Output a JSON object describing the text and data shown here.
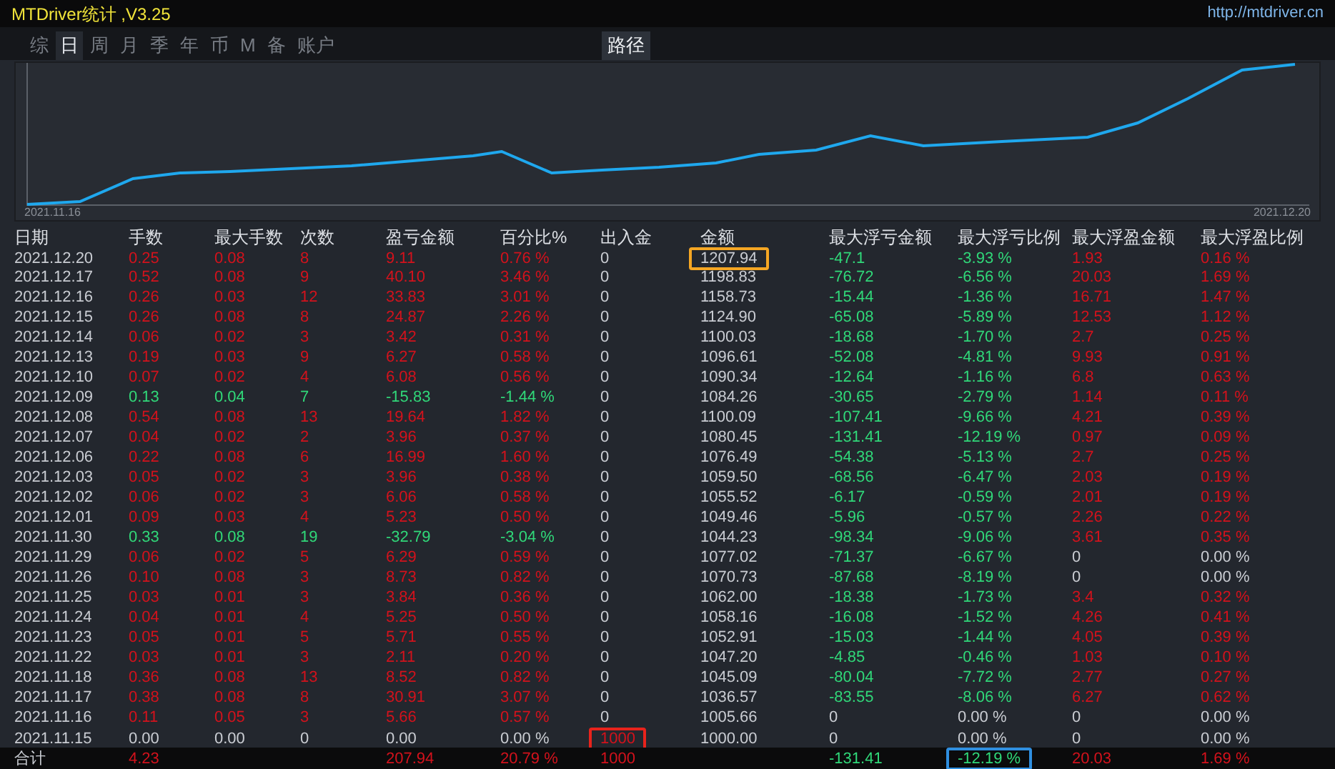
{
  "window": {
    "title": "MTDriver统计 ,V3.25",
    "link": "http://mtdriver.cn"
  },
  "tabs": [
    {
      "label": "综",
      "selected": false
    },
    {
      "label": "日",
      "selected": true
    },
    {
      "label": "周",
      "selected": false
    },
    {
      "label": "月",
      "selected": false
    },
    {
      "label": "季",
      "selected": false
    },
    {
      "label": "年",
      "selected": false
    },
    {
      "label": "币",
      "selected": false
    },
    {
      "label": "M",
      "selected": false
    },
    {
      "label": "备",
      "selected": false
    },
    {
      "label": "账户",
      "selected": false
    }
  ],
  "view_tabs": [
    {
      "label": "路径",
      "selected": true
    }
  ],
  "chart": {
    "start_label": "2021.11.16",
    "end_label": "2021.12.20"
  },
  "table": {
    "columns": [
      "日期",
      "手数",
      "最大手数",
      "次数",
      "盈亏金额",
      "百分比%",
      "出入金",
      "金额",
      "最大浮亏金额",
      "最大浮亏比例",
      "最大浮盈金额",
      "最大浮盈比例"
    ],
    "rows": [
      [
        {
          "text": "2021.12.20",
          "kind": "plain"
        },
        {
          "text": "0.25",
          "kind": "profit"
        },
        {
          "text": "0.08",
          "kind": "profit"
        },
        {
          "text": "8",
          "kind": "profit"
        },
        {
          "text": "9.11",
          "kind": "profit"
        },
        {
          "text": "0.76 %",
          "kind": "profit"
        },
        {
          "text": "0",
          "kind": "plain"
        },
        {
          "text": "1207.94",
          "kind": "plain",
          "color": "#f5a623"
        },
        {
          "text": "-47.1",
          "kind": "loss"
        },
        {
          "text": "-3.93 %",
          "kind": "loss"
        },
        {
          "text": "1.93",
          "kind": "profit"
        },
        {
          "text": "0.16 %",
          "kind": "profit"
        }
      ],
      [
        {
          "text": "2021.12.17",
          "kind": "plain"
        },
        {
          "text": "0.52",
          "kind": "profit"
        },
        {
          "text": "0.08",
          "kind": "profit"
        },
        {
          "text": "9",
          "kind": "profit"
        },
        {
          "text": "40.10",
          "kind": "profit"
        },
        {
          "text": "3.46 %",
          "kind": "profit"
        },
        {
          "text": "0",
          "kind": "plain"
        },
        {
          "text": "1198.83",
          "kind": "plain"
        },
        {
          "text": "-76.72",
          "kind": "loss"
        },
        {
          "text": "-6.56 %",
          "kind": "loss"
        },
        {
          "text": "20.03",
          "kind": "profit"
        },
        {
          "text": "1.69 %",
          "kind": "profit"
        }
      ],
      [
        {
          "text": "2021.12.16",
          "kind": "plain"
        },
        {
          "text": "0.26",
          "kind": "profit"
        },
        {
          "text": "0.03",
          "kind": "profit"
        },
        {
          "text": "12",
          "kind": "profit"
        },
        {
          "text": "33.83",
          "kind": "profit"
        },
        {
          "text": "3.01 %",
          "kind": "profit"
        },
        {
          "text": "0",
          "kind": "plain"
        },
        {
          "text": "1158.73",
          "kind": "plain"
        },
        {
          "text": "-15.44",
          "kind": "loss"
        },
        {
          "text": "-1.36 %",
          "kind": "loss"
        },
        {
          "text": "16.71",
          "kind": "profit"
        },
        {
          "text": "1.47 %",
          "kind": "profit"
        }
      ],
      [
        {
          "text": "2021.12.15",
          "kind": "plain"
        },
        {
          "text": "0.26",
          "kind": "profit"
        },
        {
          "text": "0.08",
          "kind": "profit"
        },
        {
          "text": "8",
          "kind": "profit"
        },
        {
          "text": "24.87",
          "kind": "profit"
        },
        {
          "text": "2.26 %",
          "kind": "profit"
        },
        {
          "text": "0",
          "kind": "plain"
        },
        {
          "text": "1124.90",
          "kind": "plain"
        },
        {
          "text": "-65.08",
          "kind": "loss"
        },
        {
          "text": "-5.89 %",
          "kind": "loss"
        },
        {
          "text": "12.53",
          "kind": "profit"
        },
        {
          "text": "1.12 %",
          "kind": "profit"
        }
      ],
      [
        {
          "text": "2021.12.14",
          "kind": "plain"
        },
        {
          "text": "0.06",
          "kind": "profit"
        },
        {
          "text": "0.02",
          "kind": "profit"
        },
        {
          "text": "3",
          "kind": "profit"
        },
        {
          "text": "3.42",
          "kind": "profit"
        },
        {
          "text": "0.31 %",
          "kind": "profit"
        },
        {
          "text": "0",
          "kind": "plain"
        },
        {
          "text": "1100.03",
          "kind": "plain"
        },
        {
          "text": "-18.68",
          "kind": "loss"
        },
        {
          "text": "-1.70 %",
          "kind": "loss"
        },
        {
          "text": "2.7",
          "kind": "profit"
        },
        {
          "text": "0.25 %",
          "kind": "profit"
        }
      ],
      [
        {
          "text": "2021.12.13",
          "kind": "plain"
        },
        {
          "text": "0.19",
          "kind": "profit"
        },
        {
          "text": "0.03",
          "kind": "profit"
        },
        {
          "text": "9",
          "kind": "profit"
        },
        {
          "text": "6.27",
          "kind": "profit"
        },
        {
          "text": "0.58 %",
          "kind": "profit"
        },
        {
          "text": "0",
          "kind": "plain"
        },
        {
          "text": "1096.61",
          "kind": "plain"
        },
        {
          "text": "-52.08",
          "kind": "loss"
        },
        {
          "text": "-4.81 %",
          "kind": "loss"
        },
        {
          "text": "9.93",
          "kind": "profit"
        },
        {
          "text": "0.91 %",
          "kind": "profit"
        }
      ],
      [
        {
          "text": "2021.12.10",
          "kind": "plain"
        },
        {
          "text": "0.07",
          "kind": "profit"
        },
        {
          "text": "0.02",
          "kind": "profit"
        },
        {
          "text": "4",
          "kind": "profit"
        },
        {
          "text": "6.08",
          "kind": "profit"
        },
        {
          "text": "0.56 %",
          "kind": "profit"
        },
        {
          "text": "0",
          "kind": "plain"
        },
        {
          "text": "1090.34",
          "kind": "plain"
        },
        {
          "text": "-12.64",
          "kind": "loss"
        },
        {
          "text": "-1.16 %",
          "kind": "loss"
        },
        {
          "text": "6.8",
          "kind": "profit"
        },
        {
          "text": "0.63 %",
          "kind": "profit"
        }
      ],
      [
        {
          "text": "2021.12.09",
          "kind": "plain"
        },
        {
          "text": "0.13",
          "kind": "loss"
        },
        {
          "text": "0.04",
          "kind": "loss"
        },
        {
          "text": "7",
          "kind": "loss"
        },
        {
          "text": "-15.83",
          "kind": "loss"
        },
        {
          "text": "-1.44 %",
          "kind": "loss"
        },
        {
          "text": "0",
          "kind": "plain"
        },
        {
          "text": "1084.26",
          "kind": "plain"
        },
        {
          "text": "-30.65",
          "kind": "loss"
        },
        {
          "text": "-2.79 %",
          "kind": "loss"
        },
        {
          "text": "1.14",
          "kind": "profit"
        },
        {
          "text": "0.11 %",
          "kind": "profit"
        }
      ],
      [
        {
          "text": "2021.12.08",
          "kind": "plain"
        },
        {
          "text": "0.54",
          "kind": "profit"
        },
        {
          "text": "0.08",
          "kind": "profit"
        },
        {
          "text": "13",
          "kind": "profit"
        },
        {
          "text": "19.64",
          "kind": "profit"
        },
        {
          "text": "1.82 %",
          "kind": "profit"
        },
        {
          "text": "0",
          "kind": "plain"
        },
        {
          "text": "1100.09",
          "kind": "plain"
        },
        {
          "text": "-107.41",
          "kind": "loss"
        },
        {
          "text": "-9.66 %",
          "kind": "loss"
        },
        {
          "text": "4.21",
          "kind": "profit"
        },
        {
          "text": "0.39 %",
          "kind": "profit"
        }
      ],
      [
        {
          "text": "2021.12.07",
          "kind": "plain"
        },
        {
          "text": "0.04",
          "kind": "profit"
        },
        {
          "text": "0.02",
          "kind": "profit"
        },
        {
          "text": "2",
          "kind": "profit"
        },
        {
          "text": "3.96",
          "kind": "profit"
        },
        {
          "text": "0.37 %",
          "kind": "profit"
        },
        {
          "text": "0",
          "kind": "plain"
        },
        {
          "text": "1080.45",
          "kind": "plain"
        },
        {
          "text": "-131.41",
          "kind": "loss"
        },
        {
          "text": "-12.19 %",
          "kind": "loss"
        },
        {
          "text": "0.97",
          "kind": "profit"
        },
        {
          "text": "0.09 %",
          "kind": "profit"
        }
      ],
      [
        {
          "text": "2021.12.06",
          "kind": "plain"
        },
        {
          "text": "0.22",
          "kind": "profit"
        },
        {
          "text": "0.08",
          "kind": "profit"
        },
        {
          "text": "6",
          "kind": "profit"
        },
        {
          "text": "16.99",
          "kind": "profit"
        },
        {
          "text": "1.60 %",
          "kind": "profit"
        },
        {
          "text": "0",
          "kind": "plain"
        },
        {
          "text": "1076.49",
          "kind": "plain"
        },
        {
          "text": "-54.38",
          "kind": "loss"
        },
        {
          "text": "-5.13 %",
          "kind": "loss"
        },
        {
          "text": "2.7",
          "kind": "profit"
        },
        {
          "text": "0.25 %",
          "kind": "profit"
        }
      ],
      [
        {
          "text": "2021.12.03",
          "kind": "plain"
        },
        {
          "text": "0.05",
          "kind": "profit"
        },
        {
          "text": "0.02",
          "kind": "profit"
        },
        {
          "text": "3",
          "kind": "profit"
        },
        {
          "text": "3.96",
          "kind": "profit"
        },
        {
          "text": "0.38 %",
          "kind": "profit"
        },
        {
          "text": "0",
          "kind": "plain"
        },
        {
          "text": "1059.50",
          "kind": "plain"
        },
        {
          "text": "-68.56",
          "kind": "loss"
        },
        {
          "text": "-6.47 %",
          "kind": "loss"
        },
        {
          "text": "2.03",
          "kind": "profit"
        },
        {
          "text": "0.19 %",
          "kind": "profit"
        }
      ],
      [
        {
          "text": "2021.12.02",
          "kind": "plain"
        },
        {
          "text": "0.06",
          "kind": "profit"
        },
        {
          "text": "0.02",
          "kind": "profit"
        },
        {
          "text": "3",
          "kind": "profit"
        },
        {
          "text": "6.06",
          "kind": "profit"
        },
        {
          "text": "0.58 %",
          "kind": "profit"
        },
        {
          "text": "0",
          "kind": "plain"
        },
        {
          "text": "1055.52",
          "kind": "plain"
        },
        {
          "text": "-6.17",
          "kind": "loss"
        },
        {
          "text": "-0.59 %",
          "kind": "loss"
        },
        {
          "text": "2.01",
          "kind": "profit"
        },
        {
          "text": "0.19 %",
          "kind": "profit"
        }
      ],
      [
        {
          "text": "2021.12.01",
          "kind": "plain"
        },
        {
          "text": "0.09",
          "kind": "profit"
        },
        {
          "text": "0.03",
          "kind": "profit"
        },
        {
          "text": "4",
          "kind": "profit"
        },
        {
          "text": "5.23",
          "kind": "profit"
        },
        {
          "text": "0.50 %",
          "kind": "profit"
        },
        {
          "text": "0",
          "kind": "plain"
        },
        {
          "text": "1049.46",
          "kind": "plain"
        },
        {
          "text": "-5.96",
          "kind": "loss"
        },
        {
          "text": "-0.57 %",
          "kind": "loss"
        },
        {
          "text": "2.26",
          "kind": "profit"
        },
        {
          "text": "0.22 %",
          "kind": "profit"
        }
      ],
      [
        {
          "text": "2021.11.30",
          "kind": "plain"
        },
        {
          "text": "0.33",
          "kind": "loss"
        },
        {
          "text": "0.08",
          "kind": "loss"
        },
        {
          "text": "19",
          "kind": "loss"
        },
        {
          "text": "-32.79",
          "kind": "loss"
        },
        {
          "text": "-3.04 %",
          "kind": "loss"
        },
        {
          "text": "0",
          "kind": "plain"
        },
        {
          "text": "1044.23",
          "kind": "plain"
        },
        {
          "text": "-98.34",
          "kind": "loss"
        },
        {
          "text": "-9.06 %",
          "kind": "loss"
        },
        {
          "text": "3.61",
          "kind": "profit"
        },
        {
          "text": "0.35 %",
          "kind": "profit"
        }
      ],
      [
        {
          "text": "2021.11.29",
          "kind": "plain"
        },
        {
          "text": "0.06",
          "kind": "profit"
        },
        {
          "text": "0.02",
          "kind": "profit"
        },
        {
          "text": "5",
          "kind": "profit"
        },
        {
          "text": "6.29",
          "kind": "profit"
        },
        {
          "text": "0.59 %",
          "kind": "profit"
        },
        {
          "text": "0",
          "kind": "plain"
        },
        {
          "text": "1077.02",
          "kind": "plain"
        },
        {
          "text": "-71.37",
          "kind": "loss"
        },
        {
          "text": "-6.67 %",
          "kind": "loss"
        },
        {
          "text": "0",
          "kind": "plain"
        },
        {
          "text": "0.00 %",
          "kind": "plain"
        }
      ],
      [
        {
          "text": "2021.11.26",
          "kind": "plain"
        },
        {
          "text": "0.10",
          "kind": "profit"
        },
        {
          "text": "0.08",
          "kind": "profit"
        },
        {
          "text": "3",
          "kind": "profit"
        },
        {
          "text": "8.73",
          "kind": "profit"
        },
        {
          "text": "0.82 %",
          "kind": "profit"
        },
        {
          "text": "0",
          "kind": "plain"
        },
        {
          "text": "1070.73",
          "kind": "plain"
        },
        {
          "text": "-87.68",
          "kind": "loss"
        },
        {
          "text": "-8.19 %",
          "kind": "loss"
        },
        {
          "text": "0",
          "kind": "plain"
        },
        {
          "text": "0.00 %",
          "kind": "plain"
        }
      ],
      [
        {
          "text": "2021.11.25",
          "kind": "plain"
        },
        {
          "text": "0.03",
          "kind": "profit"
        },
        {
          "text": "0.01",
          "kind": "profit"
        },
        {
          "text": "3",
          "kind": "profit"
        },
        {
          "text": "3.84",
          "kind": "profit"
        },
        {
          "text": "0.36 %",
          "kind": "profit"
        },
        {
          "text": "0",
          "kind": "plain"
        },
        {
          "text": "1062.00",
          "kind": "plain"
        },
        {
          "text": "-18.38",
          "kind": "loss"
        },
        {
          "text": "-1.73 %",
          "kind": "loss"
        },
        {
          "text": "3.4",
          "kind": "profit"
        },
        {
          "text": "0.32 %",
          "kind": "profit"
        }
      ],
      [
        {
          "text": "2021.11.24",
          "kind": "plain"
        },
        {
          "text": "0.04",
          "kind": "profit"
        },
        {
          "text": "0.01",
          "kind": "profit"
        },
        {
          "text": "4",
          "kind": "profit"
        },
        {
          "text": "5.25",
          "kind": "profit"
        },
        {
          "text": "0.50 %",
          "kind": "profit"
        },
        {
          "text": "0",
          "kind": "plain"
        },
        {
          "text": "1058.16",
          "kind": "plain"
        },
        {
          "text": "-16.08",
          "kind": "loss"
        },
        {
          "text": "-1.52 %",
          "kind": "loss"
        },
        {
          "text": "4.26",
          "kind": "profit"
        },
        {
          "text": "0.41 %",
          "kind": "profit"
        }
      ],
      [
        {
          "text": "2021.11.23",
          "kind": "plain"
        },
        {
          "text": "0.05",
          "kind": "profit"
        },
        {
          "text": "0.01",
          "kind": "profit"
        },
        {
          "text": "5",
          "kind": "profit"
        },
        {
          "text": "5.71",
          "kind": "profit"
        },
        {
          "text": "0.55 %",
          "kind": "profit"
        },
        {
          "text": "0",
          "kind": "plain"
        },
        {
          "text": "1052.91",
          "kind": "plain"
        },
        {
          "text": "-15.03",
          "kind": "loss"
        },
        {
          "text": "-1.44 %",
          "kind": "loss"
        },
        {
          "text": "4.05",
          "kind": "profit"
        },
        {
          "text": "0.39 %",
          "kind": "profit"
        }
      ],
      [
        {
          "text": "2021.11.22",
          "kind": "plain"
        },
        {
          "text": "0.03",
          "kind": "profit"
        },
        {
          "text": "0.01",
          "kind": "profit"
        },
        {
          "text": "3",
          "kind": "profit"
        },
        {
          "text": "2.11",
          "kind": "profit"
        },
        {
          "text": "0.20 %",
          "kind": "profit"
        },
        {
          "text": "0",
          "kind": "plain"
        },
        {
          "text": "1047.20",
          "kind": "plain"
        },
        {
          "text": "-4.85",
          "kind": "loss"
        },
        {
          "text": "-0.46 %",
          "kind": "loss"
        },
        {
          "text": "1.03",
          "kind": "profit"
        },
        {
          "text": "0.10 %",
          "kind": "profit"
        }
      ],
      [
        {
          "text": "2021.11.18",
          "kind": "plain"
        },
        {
          "text": "0.36",
          "kind": "profit"
        },
        {
          "text": "0.08",
          "kind": "profit"
        },
        {
          "text": "13",
          "kind": "profit"
        },
        {
          "text": "8.52",
          "kind": "profit"
        },
        {
          "text": "0.82 %",
          "kind": "profit"
        },
        {
          "text": "0",
          "kind": "plain"
        },
        {
          "text": "1045.09",
          "kind": "plain"
        },
        {
          "text": "-80.04",
          "kind": "loss"
        },
        {
          "text": "-7.72 %",
          "kind": "loss"
        },
        {
          "text": "2.77",
          "kind": "profit"
        },
        {
          "text": "0.27 %",
          "kind": "profit"
        }
      ],
      [
        {
          "text": "2021.11.17",
          "kind": "plain"
        },
        {
          "text": "0.38",
          "kind": "profit"
        },
        {
          "text": "0.08",
          "kind": "profit"
        },
        {
          "text": "8",
          "kind": "profit"
        },
        {
          "text": "30.91",
          "kind": "profit"
        },
        {
          "text": "3.07 %",
          "kind": "profit"
        },
        {
          "text": "0",
          "kind": "plain"
        },
        {
          "text": "1036.57",
          "kind": "plain"
        },
        {
          "text": "-83.55",
          "kind": "loss"
        },
        {
          "text": "-8.06 %",
          "kind": "loss"
        },
        {
          "text": "6.27",
          "kind": "profit"
        },
        {
          "text": "0.62 %",
          "kind": "profit"
        }
      ],
      [
        {
          "text": "2021.11.16",
          "kind": "plain"
        },
        {
          "text": "0.11",
          "kind": "profit"
        },
        {
          "text": "0.05",
          "kind": "profit"
        },
        {
          "text": "3",
          "kind": "profit"
        },
        {
          "text": "5.66",
          "kind": "profit"
        },
        {
          "text": "0.57 %",
          "kind": "profit"
        },
        {
          "text": "0",
          "kind": "plain"
        },
        {
          "text": "1005.66",
          "kind": "plain"
        },
        {
          "text": "0",
          "kind": "plain"
        },
        {
          "text": "0.00 %",
          "kind": "plain"
        },
        {
          "text": "0",
          "kind": "plain"
        },
        {
          "text": "0.00 %",
          "kind": "plain"
        }
      ],
      [
        {
          "text": "2021.11.15",
          "kind": "plain"
        },
        {
          "text": "0.00",
          "kind": "plain"
        },
        {
          "text": "0.00",
          "kind": "plain"
        },
        {
          "text": "0",
          "kind": "plain"
        },
        {
          "text": "0.00",
          "kind": "plain"
        },
        {
          "text": "0.00 %",
          "kind": "plain"
        },
        {
          "text": "1000",
          "kind": "profit",
          "color": "#e8231c"
        },
        {
          "text": "1000.00",
          "kind": "plain"
        },
        {
          "text": "0",
          "kind": "plain"
        },
        {
          "text": "0.00 %",
          "kind": "plain"
        },
        {
          "text": "0",
          "kind": "plain"
        },
        {
          "text": "0.00 %",
          "kind": "plain"
        }
      ]
    ],
    "total": [
      {
        "text": "合计",
        "kind": "plain"
      },
      {
        "text": "4.23",
        "kind": "profit"
      },
      {
        "kind": "blank"
      },
      {
        "kind": "blank"
      },
      {
        "text": "207.94",
        "kind": "profit"
      },
      {
        "text": "20.79 %",
        "kind": "profit"
      },
      {
        "text": "1000",
        "kind": "profit"
      },
      {
        "kind": "blank"
      },
      {
        "text": "-131.41",
        "kind": "loss"
      },
      {
        "text": "-12.19 %",
        "kind": "loss",
        "color": "#2f8fe0"
      },
      {
        "text": "20.03",
        "kind": "profit"
      },
      {
        "text": "1.69 %",
        "kind": "profit"
      }
    ]
  }
}
